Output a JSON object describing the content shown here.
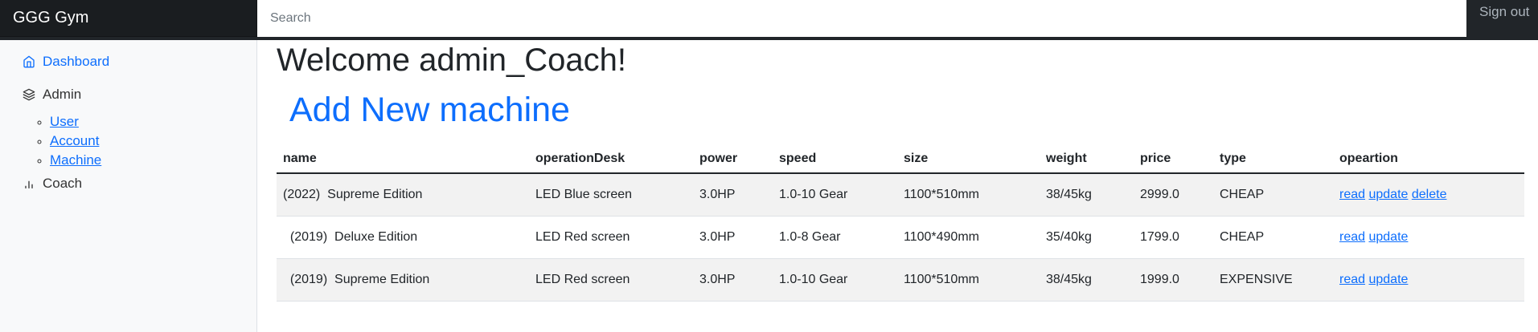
{
  "navbar": {
    "brand": "GGG Gym",
    "search_placeholder": "Search",
    "signout": "Sign out"
  },
  "sidebar": {
    "dashboard": "Dashboard",
    "admin": "Admin",
    "admin_items": [
      "User",
      "Account",
      "Machine"
    ],
    "coach": "Coach"
  },
  "main": {
    "welcome": "Welcome admin_Coach!",
    "add_link": "Add New machine"
  },
  "table": {
    "headers": [
      "name",
      "operationDesk",
      "power",
      "speed",
      "size",
      "weight",
      "price",
      "type",
      "opeartion"
    ],
    "rows": [
      {
        "name": "(2022)  Supreme Edition",
        "operationDesk": "LED Blue screen",
        "power": "3.0HP",
        "speed": "1.0-10 Gear",
        "size": "1100*510mm",
        "weight": "38/45kg",
        "price": "2999.0",
        "type": "CHEAP",
        "actions": [
          "read",
          "update",
          "delete"
        ]
      },
      {
        "name": "  (2019)  Deluxe Edition",
        "operationDesk": "LED Red screen",
        "power": "3.0HP",
        "speed": "1.0-8 Gear",
        "size": "1100*490mm",
        "weight": "35/40kg",
        "price": "1799.0",
        "type": "CHEAP",
        "actions": [
          "read",
          "update"
        ]
      },
      {
        "name": "  (2019)  Supreme Edition",
        "operationDesk": "LED Red screen",
        "power": "3.0HP",
        "speed": "1.0-10 Gear",
        "size": "1100*510mm",
        "weight": "38/45kg",
        "price": "1999.0",
        "type": "EXPENSIVE",
        "actions": [
          "read",
          "update"
        ]
      }
    ]
  },
  "colors": {
    "navbar_bg": "#212529",
    "link": "#0d6efd",
    "striped_row": "#f2f2f2"
  }
}
